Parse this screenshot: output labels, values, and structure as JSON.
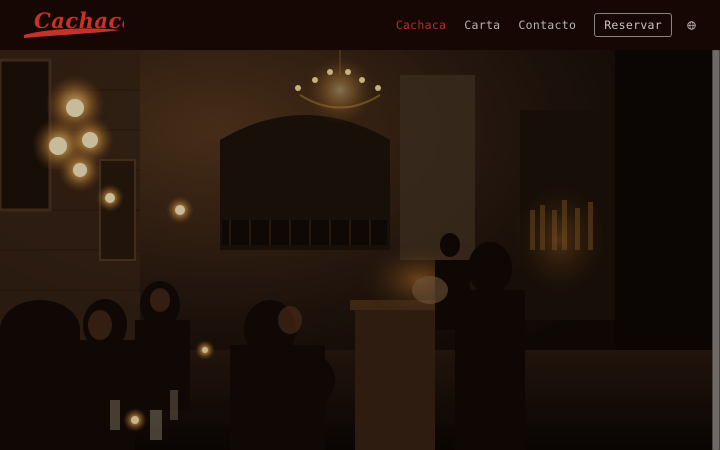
{
  "brand": {
    "logo_text": "Cachaca",
    "logo_color": "#c8312a"
  },
  "nav": {
    "links": [
      {
        "label": "Cachaca",
        "active": true
      },
      {
        "label": "Carta",
        "active": false
      },
      {
        "label": "Contacto",
        "active": false
      }
    ],
    "reserve_label": "Reservar",
    "language_icon": "globe-icon",
    "active_color": "#b4302a"
  },
  "hero": {
    "image": "dimly lit restaurant interior photo"
  }
}
